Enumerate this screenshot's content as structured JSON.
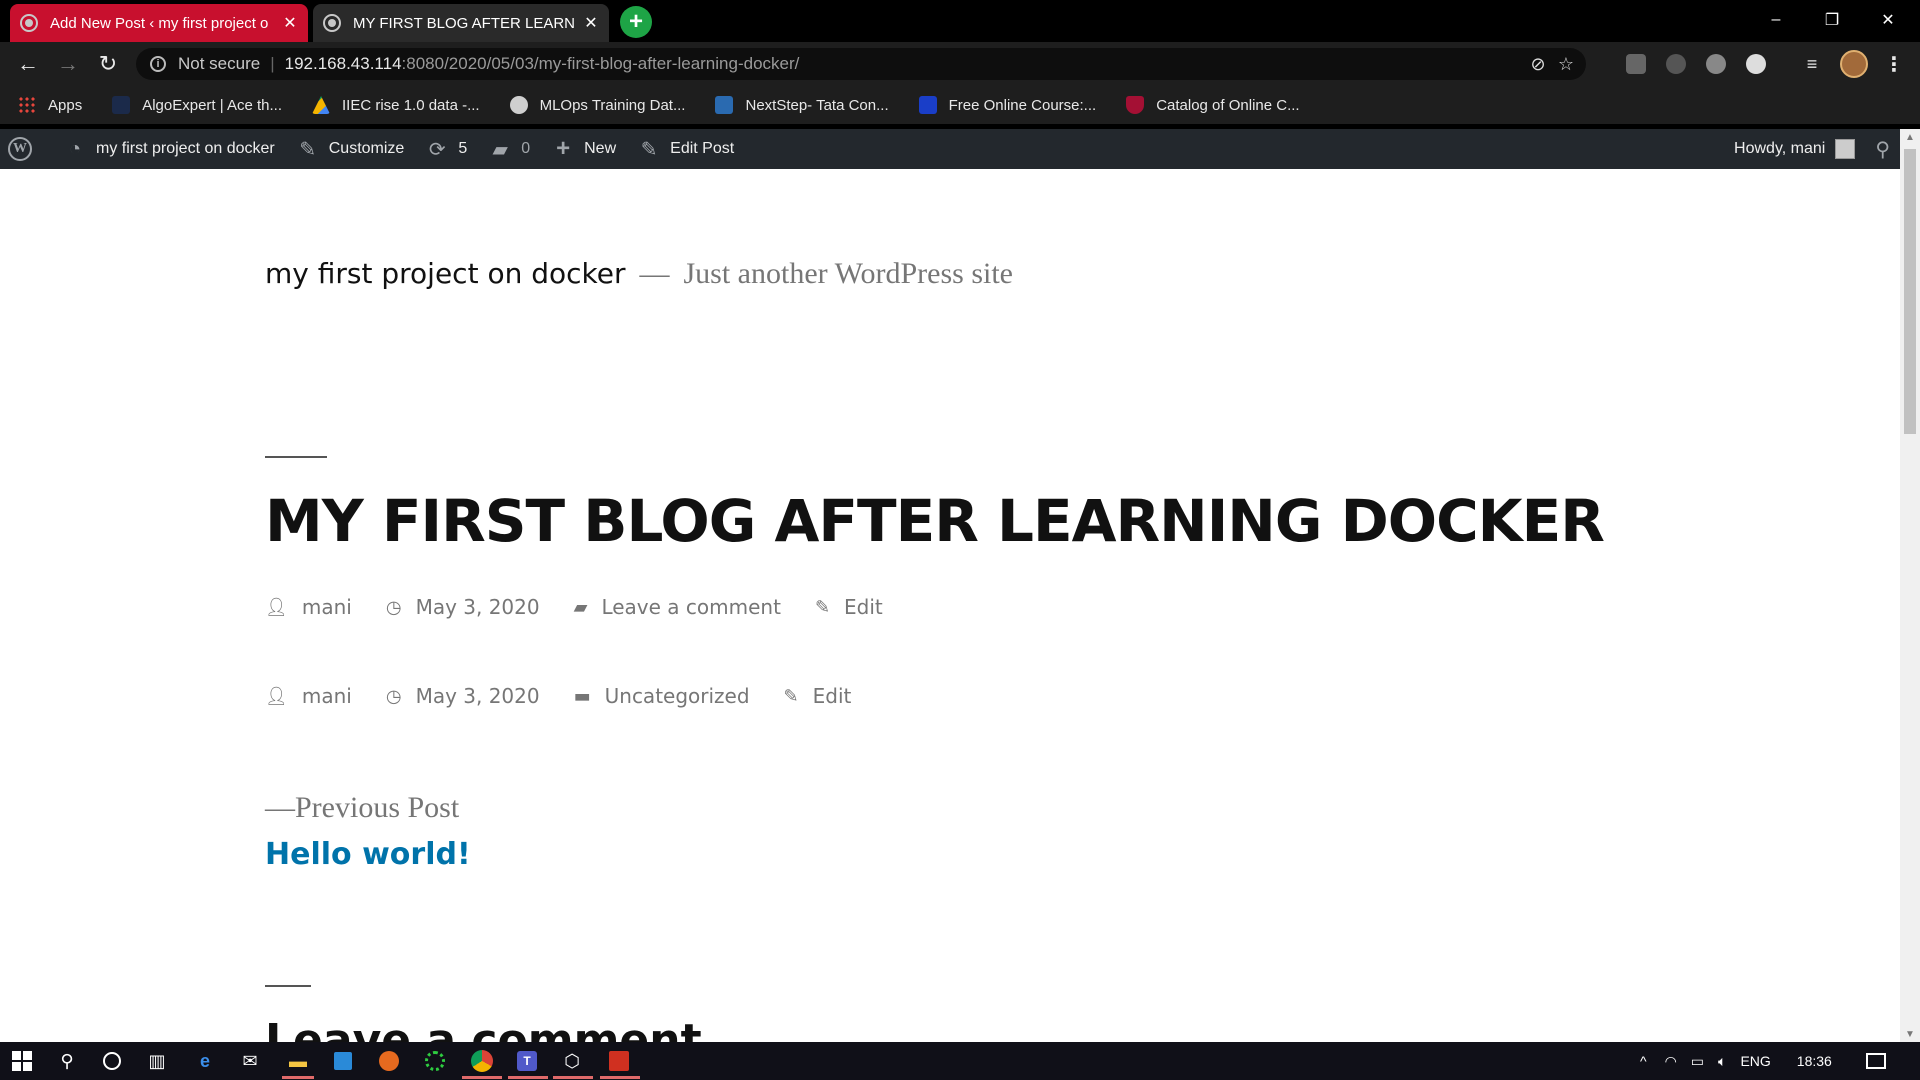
{
  "browser": {
    "tabs": [
      {
        "title": "Add New Post ‹ my first project o"
      },
      {
        "title": "MY FIRST BLOG AFTER LEARNIN"
      }
    ],
    "new_tab_label": "+",
    "window_controls": {
      "minimize": "–",
      "restore": "❐",
      "close": "✕"
    },
    "address": {
      "security_label": "Not secure",
      "host": "192.168.43.114",
      "path": ":8080/2020/05/03/my-first-blog-after-learning-docker/"
    },
    "bookmarks": [
      {
        "label": "Apps",
        "color": "#e8453c"
      },
      {
        "label": "AlgoExpert | Ace th...",
        "color": "#1b2a4a"
      },
      {
        "label": "IIEC rise 1.0 data -...",
        "color": "#f4b400"
      },
      {
        "label": "MLOps Training Dat...",
        "color": "#cfcfcf"
      },
      {
        "label": "NextStep- Tata Con...",
        "color": "#2a6ab0"
      },
      {
        "label": "Free Online Course:...",
        "color": "#1a3ec8"
      },
      {
        "label": "Catalog of Online C...",
        "color": "#a41034"
      }
    ]
  },
  "adminbar": {
    "site_name": "my first project on docker",
    "customize": "Customize",
    "updates_count": "5",
    "comments_count": "0",
    "new_label": "New",
    "edit_post": "Edit Post",
    "howdy": "Howdy, mani"
  },
  "page": {
    "site_title": "my first project on docker",
    "site_dash": "—",
    "site_description": "Just another WordPress site",
    "post_title": "MY FIRST BLOG AFTER LEARNING DOCKER",
    "header_meta": {
      "author": "mani",
      "date": "May 3, 2020",
      "comment": "Leave a comment",
      "edit": "Edit"
    },
    "footer_meta": {
      "author": "mani",
      "date": "May 3, 2020",
      "category": "Uncategorized",
      "edit": "Edit"
    },
    "prev_label": "—Previous Post",
    "prev_link": "Hello world!",
    "comment_heading": "Leave a comment"
  },
  "taskbar": {
    "language": "ENG",
    "time": "18:36"
  }
}
